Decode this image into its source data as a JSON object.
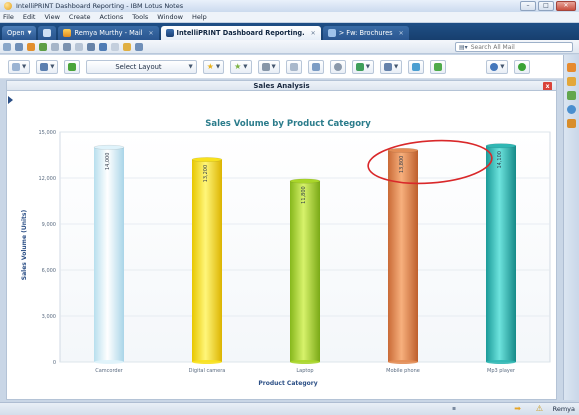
{
  "window": {
    "title": "IntelliPRINT Dashboard Reporting - IBM Lotus Notes"
  },
  "menu": [
    "File",
    "Edit",
    "View",
    "Create",
    "Actions",
    "Tools",
    "Window",
    "Help"
  ],
  "tabs": [
    {
      "label": "Open",
      "active": false
    },
    {
      "label": "",
      "active": false
    },
    {
      "label": "Remya Murthy - Mail",
      "active": false
    },
    {
      "label": "IntelliPRINT Dashboard Reporting.",
      "active": true
    },
    {
      "label": "> Fw: Brochures",
      "active": false
    }
  ],
  "search": {
    "placeholder": "Search All Mail"
  },
  "toolbar": {
    "select_layout": "Select Layout"
  },
  "panel": {
    "title": "Sales Analysis",
    "close": "x"
  },
  "status": {
    "user": "Remya"
  },
  "colors": {
    "accent": "#1f4f86",
    "title": "#2b7c8b",
    "axis_label": "#2b4f86",
    "annotation": "#d9282a"
  },
  "chart_data": {
    "type": "bar",
    "title": "Sales Volume by Product Category",
    "xlabel": "Product Category",
    "ylabel": "Sales Volume (Units)",
    "ylim": [
      0,
      15000
    ],
    "yticks": [
      "0",
      "3,000",
      "6,000",
      "9,000",
      "12,000",
      "15,000"
    ],
    "categories": [
      "Camcorder",
      "Digital camera",
      "Laptop",
      "Mobile phone",
      "Mp3 player"
    ],
    "values": [
      14000,
      13200,
      11800,
      13800,
      14100
    ],
    "value_labels": [
      "14,000",
      "13,200",
      "11,800",
      "13,800",
      "14,100"
    ],
    "colors": [
      "#dff3fb",
      "#f8e11d",
      "#a9d62a",
      "#e38d55",
      "#30b7b4"
    ],
    "grid": true,
    "annotation": "red ellipse around Mobile phone and Mp3 player bars"
  }
}
